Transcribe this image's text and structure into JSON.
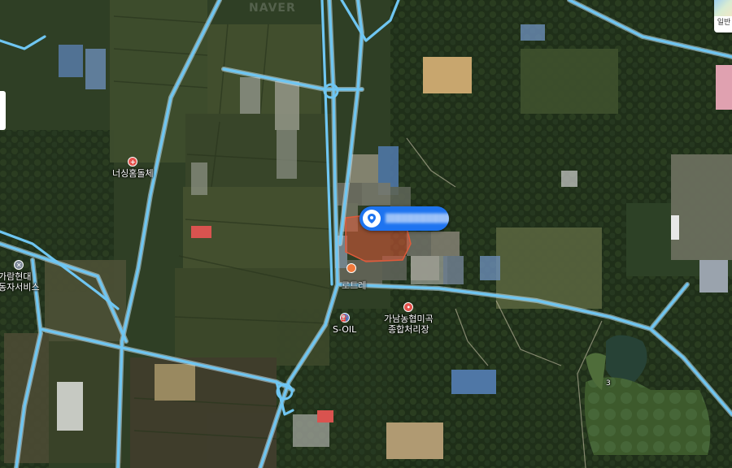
{
  "watermark": "NAVER",
  "map_type": {
    "label": "일반",
    "icon": "map-type-thumbnail-icon"
  },
  "places": [
    {
      "key": "nursing_home",
      "label": "너싱홈돌체",
      "icon": "hospital-icon",
      "color": "#e4534d"
    },
    {
      "key": "service_center",
      "label": "가람현대\n동자서비스",
      "icon": "wrench-icon",
      "color": "#7f8a99"
    },
    {
      "key": "gas_station",
      "label": "S-OIL",
      "icon": "gas-station-icon",
      "color": "#4a7bd3"
    },
    {
      "key": "rice_center",
      "label": "가남농협미곡\n종합처리장",
      "icon": "rice-icon",
      "color": "#e4534d"
    },
    {
      "key": "road_label",
      "label": "로트레",
      "icon": "",
      "color": ""
    },
    {
      "key": "golf_hole",
      "label": "3",
      "icon": "",
      "color": ""
    }
  ],
  "marker": {
    "icon": "location-marker-icon",
    "color": "#1e74f0"
  },
  "colors": {
    "road": "#6fc6f2",
    "road_outline": "#cfeeff",
    "highlight_parcel": "#e05a3a"
  }
}
